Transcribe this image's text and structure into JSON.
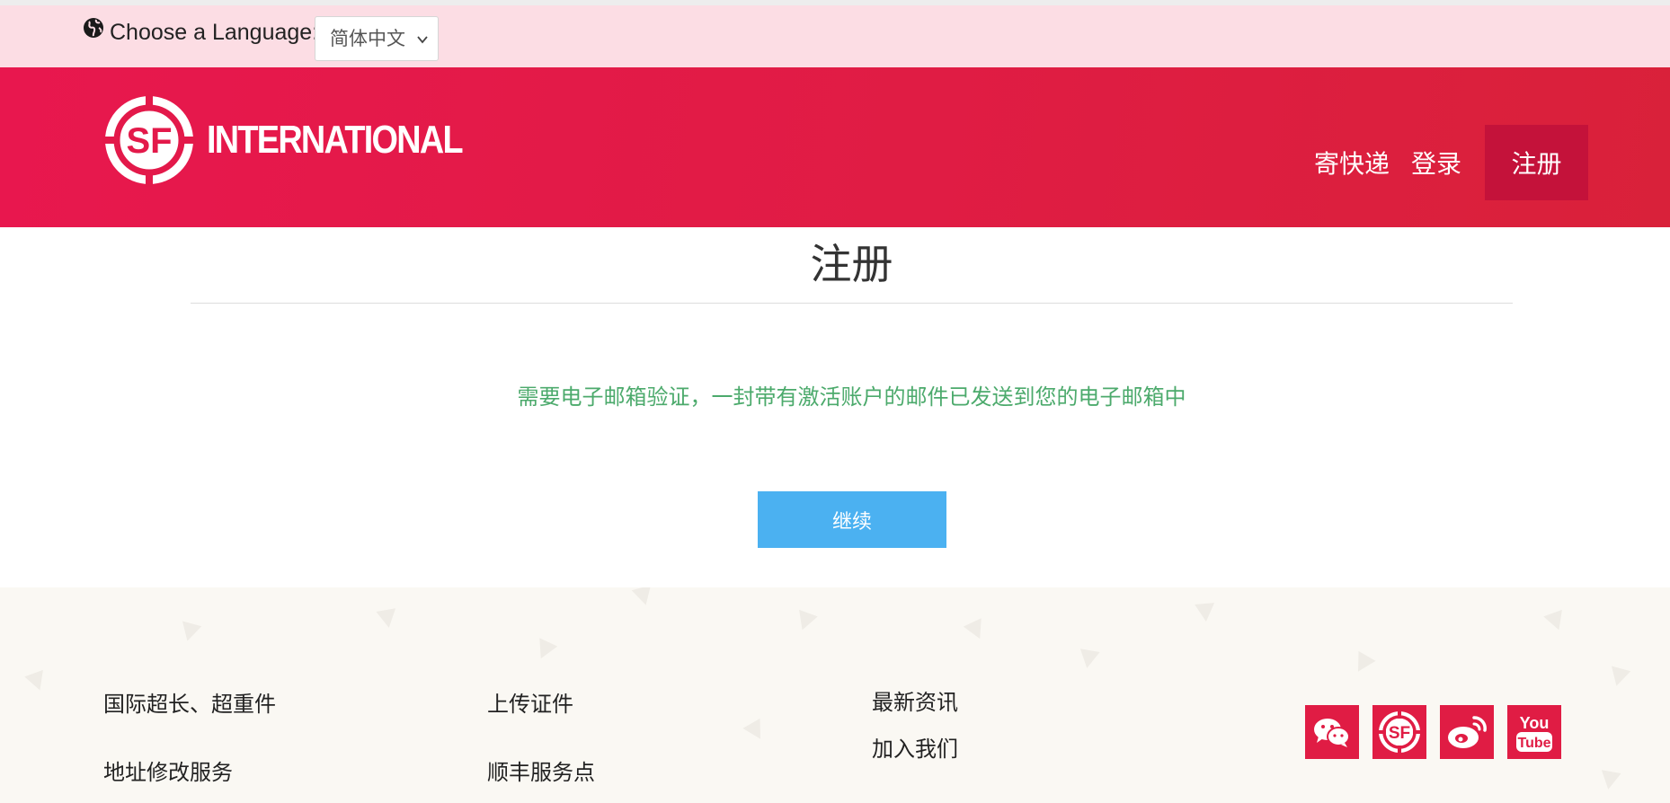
{
  "language_bar": {
    "label": "Choose a Language:",
    "selected_language": "简体中文",
    "icon": "globe-icon"
  },
  "header": {
    "logo_text": "INTERNATIONAL",
    "logo_mark": "SF",
    "nav": {
      "ship": "寄快递",
      "login": "登录",
      "register": "注册"
    },
    "colors": {
      "brand": "#e01c44",
      "active": "#c4123a"
    }
  },
  "main": {
    "title": "注册",
    "notice": "需要电子邮箱验证，一封带有激活账户的邮件已发送到您的电子邮箱中",
    "continue_label": "继续",
    "colors": {
      "notice": "#4caa6c",
      "button": "#4bb1f1"
    }
  },
  "footer": {
    "col1": [
      "国际超长、超重件",
      "地址修改服务"
    ],
    "col2": [
      "上传证件",
      "顺丰服务点"
    ],
    "col3": [
      "最新资讯",
      "加入我们"
    ],
    "social": [
      "wechat-icon",
      "sf-icon",
      "weibo-icon",
      "youtube-icon"
    ],
    "youtube_top": "You",
    "youtube_bottom": "Tube"
  }
}
